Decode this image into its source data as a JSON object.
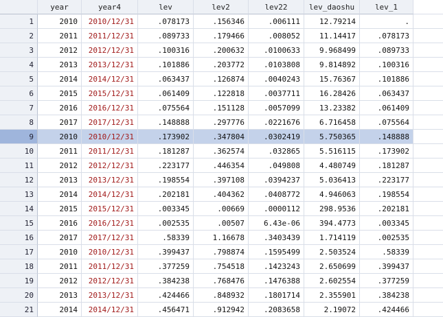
{
  "columns": [
    "year",
    "year4",
    "lev",
    "lev2",
    "lev22",
    "lev_daoshu",
    "lev_1"
  ],
  "selected_row": 9,
  "rows": [
    {
      "n": "1",
      "year": "2010",
      "year4": "2010/12/31",
      "lev": ".078173",
      "lev2": ".156346",
      "lev22": ".006111",
      "lev_daoshu": "12.79214",
      "lev_1": "."
    },
    {
      "n": "2",
      "year": "2011",
      "year4": "2011/12/31",
      "lev": ".089733",
      "lev2": ".179466",
      "lev22": ".008052",
      "lev_daoshu": "11.14417",
      "lev_1": ".078173"
    },
    {
      "n": "3",
      "year": "2012",
      "year4": "2012/12/31",
      "lev": ".100316",
      "lev2": ".200632",
      "lev22": ".0100633",
      "lev_daoshu": "9.968499",
      "lev_1": ".089733"
    },
    {
      "n": "4",
      "year": "2013",
      "year4": "2013/12/31",
      "lev": ".101886",
      "lev2": ".203772",
      "lev22": ".0103808",
      "lev_daoshu": "9.814892",
      "lev_1": ".100316"
    },
    {
      "n": "5",
      "year": "2014",
      "year4": "2014/12/31",
      "lev": ".063437",
      "lev2": ".126874",
      "lev22": ".0040243",
      "lev_daoshu": "15.76367",
      "lev_1": ".101886"
    },
    {
      "n": "6",
      "year": "2015",
      "year4": "2015/12/31",
      "lev": ".061409",
      "lev2": ".122818",
      "lev22": ".0037711",
      "lev_daoshu": "16.28426",
      "lev_1": ".063437"
    },
    {
      "n": "7",
      "year": "2016",
      "year4": "2016/12/31",
      "lev": ".075564",
      "lev2": ".151128",
      "lev22": ".0057099",
      "lev_daoshu": "13.23382",
      "lev_1": ".061409"
    },
    {
      "n": "8",
      "year": "2017",
      "year4": "2017/12/31",
      "lev": ".148888",
      "lev2": ".297776",
      "lev22": ".0221676",
      "lev_daoshu": "6.716458",
      "lev_1": ".075564"
    },
    {
      "n": "9",
      "year": "2010",
      "year4": "2010/12/31",
      "lev": ".173902",
      "lev2": ".347804",
      "lev22": ".0302419",
      "lev_daoshu": "5.750365",
      "lev_1": ".148888"
    },
    {
      "n": "10",
      "year": "2011",
      "year4": "2011/12/31",
      "lev": ".181287",
      "lev2": ".362574",
      "lev22": ".032865",
      "lev_daoshu": "5.516115",
      "lev_1": ".173902"
    },
    {
      "n": "11",
      "year": "2012",
      "year4": "2012/12/31",
      "lev": ".223177",
      "lev2": ".446354",
      "lev22": ".049808",
      "lev_daoshu": "4.480749",
      "lev_1": ".181287"
    },
    {
      "n": "12",
      "year": "2013",
      "year4": "2013/12/31",
      "lev": ".198554",
      "lev2": ".397108",
      "lev22": ".0394237",
      "lev_daoshu": "5.036413",
      "lev_1": ".223177"
    },
    {
      "n": "13",
      "year": "2014",
      "year4": "2014/12/31",
      "lev": ".202181",
      "lev2": ".404362",
      "lev22": ".0408772",
      "lev_daoshu": "4.946063",
      "lev_1": ".198554"
    },
    {
      "n": "14",
      "year": "2015",
      "year4": "2015/12/31",
      "lev": ".003345",
      "lev2": ".00669",
      "lev22": ".0000112",
      "lev_daoshu": "298.9536",
      "lev_1": ".202181"
    },
    {
      "n": "15",
      "year": "2016",
      "year4": "2016/12/31",
      "lev": ".002535",
      "lev2": ".00507",
      "lev22": "6.43e-06",
      "lev_daoshu": "394.4773",
      "lev_1": ".003345"
    },
    {
      "n": "16",
      "year": "2017",
      "year4": "2017/12/31",
      "lev": ".58339",
      "lev2": "1.16678",
      "lev22": ".3403439",
      "lev_daoshu": "1.714119",
      "lev_1": ".002535"
    },
    {
      "n": "17",
      "year": "2010",
      "year4": "2010/12/31",
      "lev": ".399437",
      "lev2": ".798874",
      "lev22": ".1595499",
      "lev_daoshu": "2.503524",
      "lev_1": ".58339"
    },
    {
      "n": "18",
      "year": "2011",
      "year4": "2011/12/31",
      "lev": ".377259",
      "lev2": ".754518",
      "lev22": ".1423243",
      "lev_daoshu": "2.650699",
      "lev_1": ".399437"
    },
    {
      "n": "19",
      "year": "2012",
      "year4": "2012/12/31",
      "lev": ".384238",
      "lev2": ".768476",
      "lev22": ".1476388",
      "lev_daoshu": "2.602554",
      "lev_1": ".377259"
    },
    {
      "n": "20",
      "year": "2013",
      "year4": "2013/12/31",
      "lev": ".424466",
      "lev2": ".848932",
      "lev22": ".1801714",
      "lev_daoshu": "2.355901",
      "lev_1": ".384238"
    },
    {
      "n": "21",
      "year": "2014",
      "year4": "2014/12/31",
      "lev": ".456471",
      "lev2": ".912942",
      "lev22": ".2083658",
      "lev_daoshu": "2.19072",
      "lev_1": ".424466"
    }
  ]
}
